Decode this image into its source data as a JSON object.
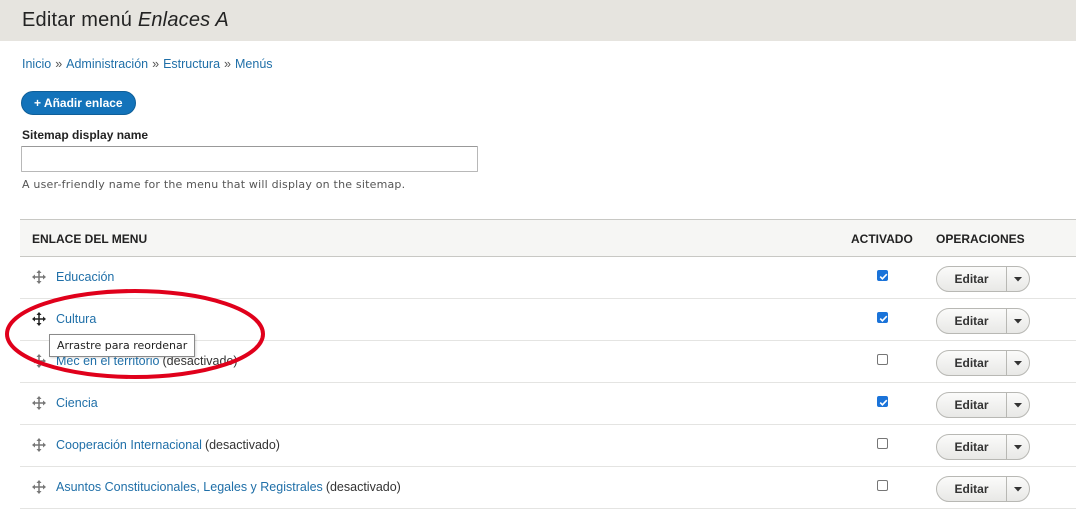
{
  "header": {
    "title_prefix": "Editar menú",
    "title_menu": "Enlaces A"
  },
  "breadcrumb": [
    {
      "label": "Inicio"
    },
    {
      "label": "Administración"
    },
    {
      "label": "Estructura"
    },
    {
      "label": "Menús"
    }
  ],
  "breadcrumb_separator": "»",
  "add_link_button": "+ Añadir enlace",
  "sitemap": {
    "label": "Sitemap display name",
    "value": "",
    "description": "A user-friendly name for the menu that will display on the sitemap."
  },
  "table": {
    "headers": {
      "link": "ENLACE DEL MENU",
      "enabled": "ACTIVADO",
      "operations": "OPERACIONES"
    },
    "rows": [
      {
        "label": "Educación",
        "note": "",
        "enabled": true,
        "edit": "Editar"
      },
      {
        "label": "Cultura",
        "note": "",
        "enabled": true,
        "edit": "Editar"
      },
      {
        "label": "Mec en el territorio",
        "note": "(desactivado)",
        "enabled": false,
        "edit": "Editar"
      },
      {
        "label": "Ciencia",
        "note": "",
        "enabled": true,
        "edit": "Editar"
      },
      {
        "label": "Cooperación Internacional",
        "note": "(desactivado)",
        "enabled": false,
        "edit": "Editar"
      },
      {
        "label": "Asuntos Constitucionales, Legales y Registrales",
        "note": "(desactivado)",
        "enabled": false,
        "edit": "Editar"
      }
    ]
  },
  "tooltip": "Arrastre para reordenar",
  "colors": {
    "link": "#1f6fa8",
    "primary_button": "#1373ba",
    "checkbox": "#1a73d9",
    "annotation": "#e0001b",
    "header_bg": "#e6e4df"
  },
  "icons": {
    "drag_handle": "move-cross-icon",
    "dropdown": "caret-down-icon",
    "check": "checkmark-icon"
  }
}
